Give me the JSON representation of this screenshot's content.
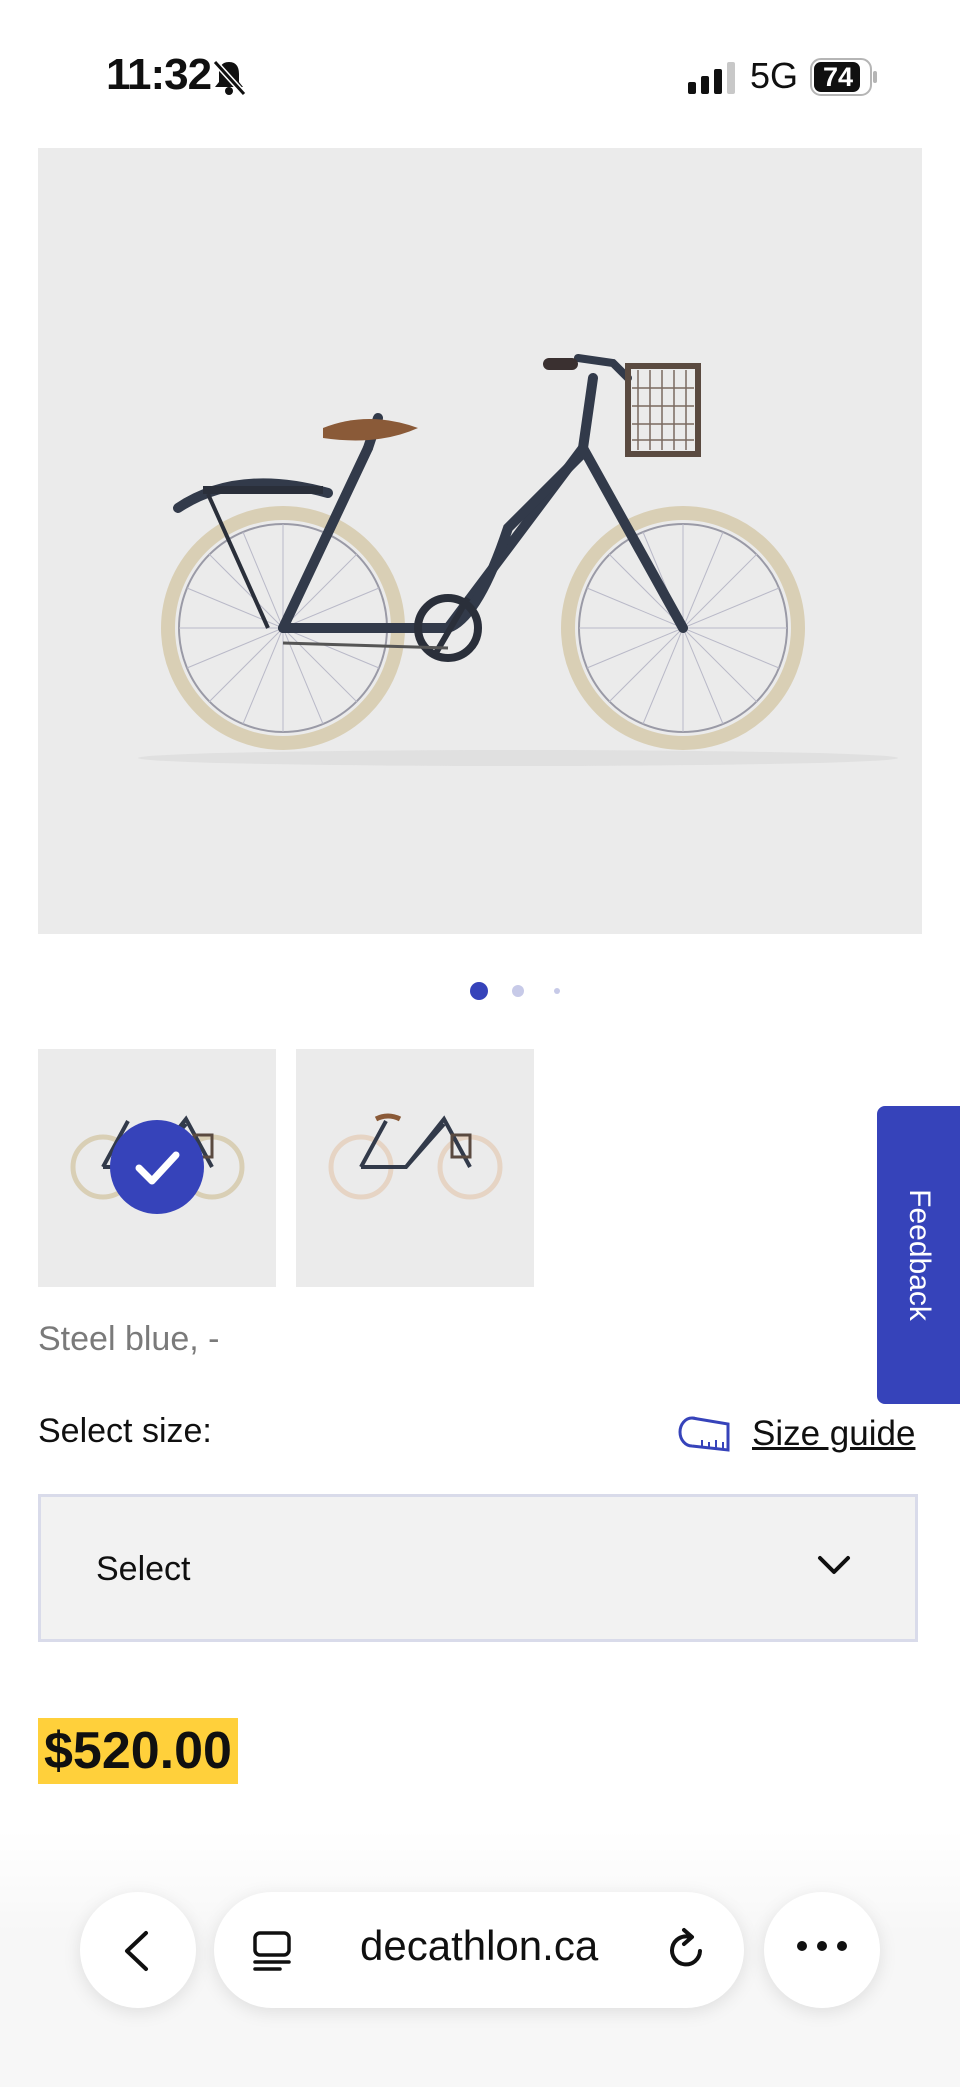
{
  "status_bar": {
    "time": "11:32",
    "network": "5G",
    "battery": "74"
  },
  "product": {
    "color_label": "Steel blue, -",
    "select_size_label": "Select size:",
    "size_guide_label": "Size guide",
    "size_select_value": "Select",
    "price": "$520.00",
    "carousel": {
      "total": 3,
      "active": 1
    },
    "thumbnails_selected": 1
  },
  "feedback_tab": {
    "label": "Feedback"
  },
  "browser": {
    "url": "decathlon.ca"
  },
  "colors": {
    "accent": "#3643ba",
    "price_highlight": "#ffd03b",
    "image_bg": "#ebebeb"
  },
  "icons": [
    "bell-slash-icon",
    "signal-icon",
    "battery-icon",
    "checkmark-icon",
    "tape-measure-icon",
    "chevron-down-icon",
    "back-icon",
    "tabs-icon",
    "reload-icon",
    "more-icon"
  ]
}
